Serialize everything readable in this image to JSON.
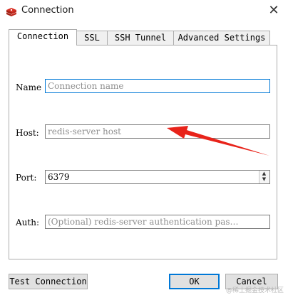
{
  "window": {
    "title": "Connection",
    "icon": "redis-logo-icon",
    "close_glyph": "✕"
  },
  "tabs": [
    {
      "label": "Connection",
      "active": true
    },
    {
      "label": "SSL",
      "active": false
    },
    {
      "label": "SSH Tunnel",
      "active": false
    },
    {
      "label": "Advanced Settings",
      "active": false
    }
  ],
  "form": {
    "name": {
      "label": "Name",
      "value": "",
      "placeholder": "Connection name"
    },
    "host": {
      "label": "Host:",
      "value": "",
      "placeholder": "redis-server host"
    },
    "port": {
      "label": "Port:",
      "value": "6379"
    },
    "auth": {
      "label": "Auth:",
      "value": "",
      "placeholder": "(Optional) redis-server authentication pas…"
    }
  },
  "buttons": {
    "test": "Test Connection",
    "ok": "OK",
    "cancel": "Cancel"
  },
  "annotation": {
    "arrow_color": "#e8231a"
  },
  "watermark": "@稀土掘金技术社区",
  "colors": {
    "accent": "#0078d7",
    "border": "#adadad"
  }
}
